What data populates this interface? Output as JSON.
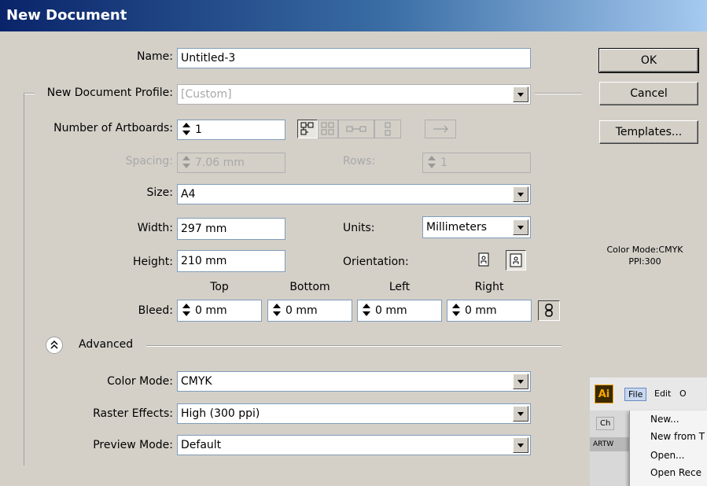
{
  "window": {
    "title": "New Document"
  },
  "form": {
    "name_label": "Name:",
    "name_value": "Untitled-3",
    "profile_label": "New Document Profile:",
    "profile_value": "[Custom]",
    "artboards_label": "Number of Artboards:",
    "artboards_value": "1",
    "spacing_label": "Spacing:",
    "spacing_value": "7.06 mm",
    "rows_label": "Rows:",
    "rows_value": "1",
    "size_label": "Size:",
    "size_value": "A4",
    "width_label": "Width:",
    "width_value": "297 mm",
    "units_label": "Units:",
    "units_value": "Millimeters",
    "height_label": "Height:",
    "height_value": "210 mm",
    "orientation_label": "Orientation:",
    "bleed_label": "Bleed:",
    "bleed_headers": {
      "top": "Top",
      "bottom": "Bottom",
      "left": "Left",
      "right": "Right"
    },
    "bleed_values": {
      "top": "0 mm",
      "bottom": "0 mm",
      "left": "0 mm",
      "right": "0 mm"
    },
    "advanced_label": "Advanced",
    "color_mode_label": "Color Mode:",
    "color_mode_value": "CMYK",
    "raster_label": "Raster Effects:",
    "raster_value": "High (300 ppi)",
    "preview_label": "Preview Mode:",
    "preview_value": "Default"
  },
  "buttons": {
    "ok": "OK",
    "cancel": "Cancel",
    "templates": "Templates..."
  },
  "info": {
    "color_mode": "Color Mode:CMYK",
    "ppi": "PPI:300"
  },
  "overlay_menu": {
    "app_icon": "Ai",
    "menubar": [
      "File",
      "Edit",
      "O"
    ],
    "items": [
      "New...",
      "New from T",
      "Open...",
      "Open Rece"
    ],
    "panel_labels": [
      "Ch",
      "ARTW"
    ]
  }
}
